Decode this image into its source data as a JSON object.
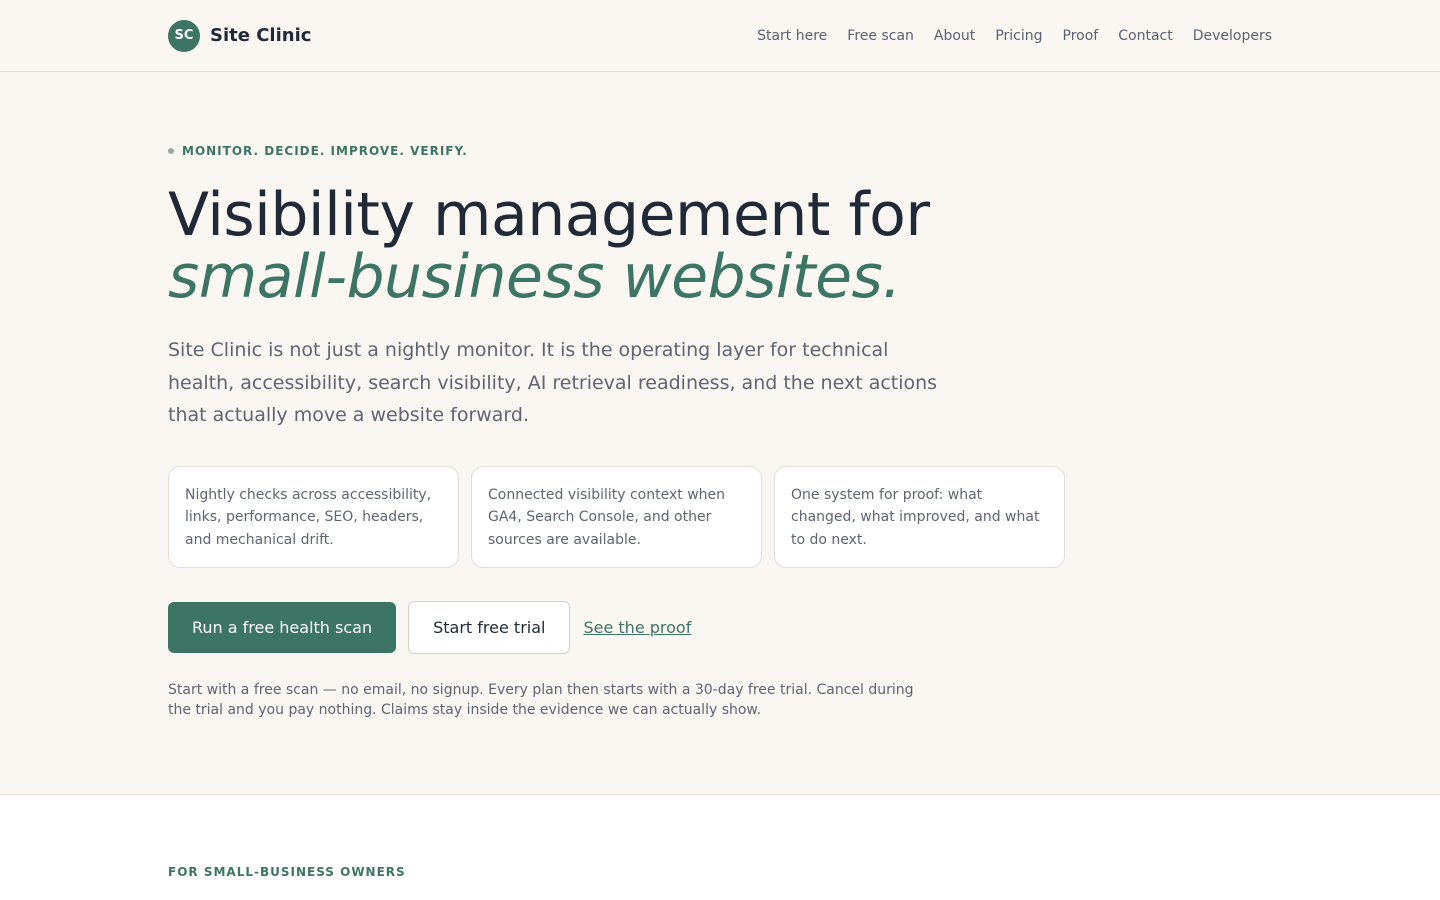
{
  "header": {
    "logo_text": "SC",
    "brand": "Site Clinic",
    "nav": [
      "Start here",
      "Free scan",
      "About",
      "Pricing",
      "Proof",
      "Contact",
      "Developers"
    ]
  },
  "hero": {
    "eyebrow": "MONITOR. DECIDE. IMPROVE. VERIFY.",
    "headline": "Visibility management for",
    "headline_accent": "small-business websites.",
    "lede": "Site Clinic is not just a nightly monitor. It is the operating layer for technical health, accessibility, search visibility, AI retrieval readiness, and the next actions that actually move a website forward.",
    "cards": [
      "Nightly checks across accessibility, links, performance, SEO, headers, and mechanical drift.",
      "Connected visibility context when GA4, Search Console, and other sources are available.",
      "One system for proof: what changed, what improved, and what to do next."
    ],
    "primary_cta": "Run a free health scan",
    "secondary_cta": "Start free trial",
    "proof_link": "See the proof",
    "fineprint": "Start with a free scan — no email, no signup. Every plan then starts with a 30-day free trial. Cancel during the trial and you pay nothing. Claims stay inside the evidence we can actually show."
  },
  "section2": {
    "label": "FOR SMALL-BUSINESS OWNERS"
  },
  "colors": {
    "accent": "#3d7564",
    "background": "#faf7f2",
    "text": "#1f2937",
    "muted": "#5f6470"
  }
}
